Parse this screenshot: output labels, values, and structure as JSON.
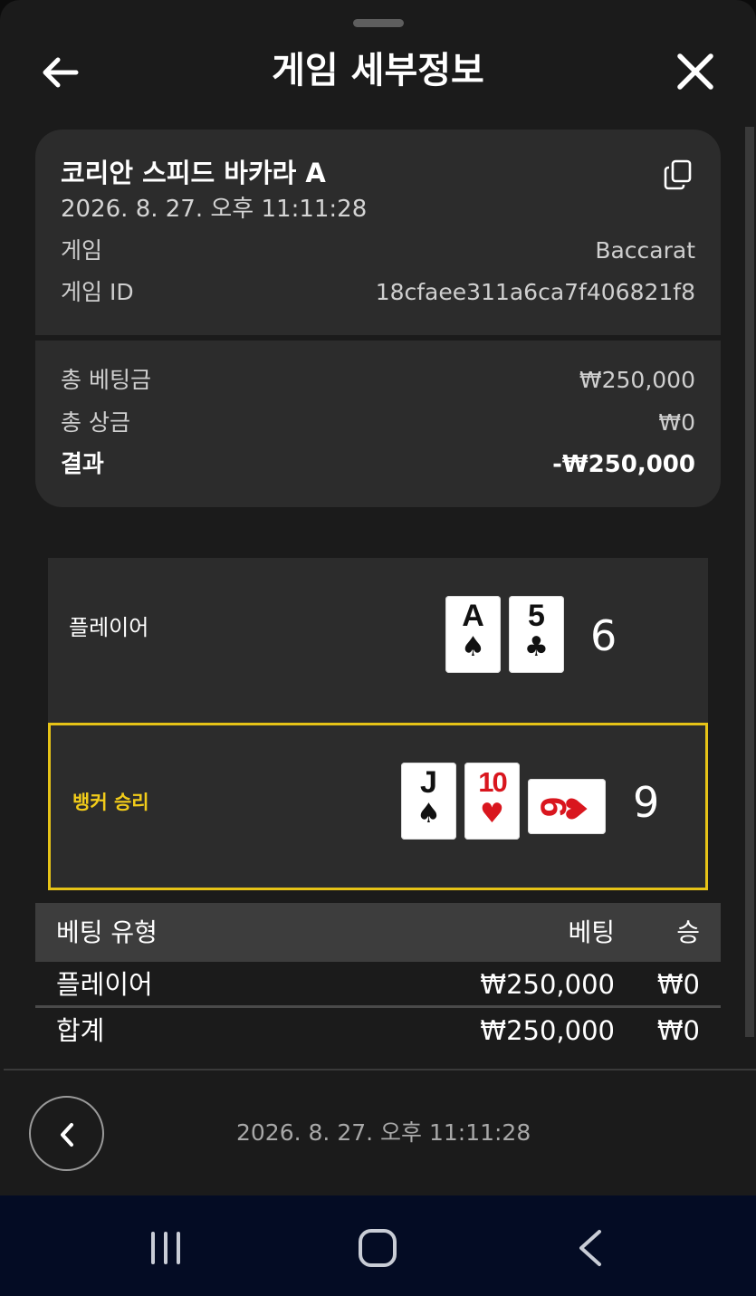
{
  "header": {
    "title": "게임 세부정보",
    "back_icon": "arrow-left-icon",
    "close_icon": "close-icon"
  },
  "summary": {
    "table_name": "코리안 스피드 바카라 A",
    "played_at": "2026. 8. 27. 오후 11:11:28",
    "copy_icon": "copy-icon",
    "game_label": "게임",
    "game_value": "Baccarat",
    "game_id_label": "게임 ID",
    "game_id_value": "18cfaee311a6ca7f406821f8",
    "total_bet_label": "총 베팅금",
    "total_bet_value": "₩250,000",
    "total_win_label": "총 상금",
    "total_win_value": "₩0",
    "result_label": "결과",
    "result_value": "-₩250,000"
  },
  "hands": {
    "player": {
      "label": "플레이어",
      "score": "6",
      "cards": [
        {
          "rank": "A",
          "suit": "♠",
          "color": "#111111"
        },
        {
          "rank": "5",
          "suit": "♣",
          "color": "#111111"
        }
      ]
    },
    "banker": {
      "label": "뱅커 승리",
      "score": "9",
      "highlight_color": "#e6c317",
      "cards": [
        {
          "rank": "J",
          "suit": "♠",
          "color": "#111111"
        },
        {
          "rank": "10",
          "suit": "♥",
          "color": "#d9161e"
        },
        {
          "rank": "9",
          "suit": "♥",
          "color": "#d9161e",
          "orientation": "sideways"
        }
      ]
    }
  },
  "bets": {
    "headers": {
      "type": "베팅 유형",
      "bet": "베팅",
      "win": "승"
    },
    "rows": [
      {
        "type": "플레이어",
        "bet": "₩250,000",
        "win": "₩0"
      }
    ],
    "total": {
      "type": "합계",
      "bet": "₩250,000",
      "win": "₩0"
    }
  },
  "footer": {
    "date": "2026. 8. 27. 오후 11:11:28",
    "prev_icon": "chevron-left-icon"
  },
  "system_nav": {
    "recents_icon": "recents-icon",
    "home_icon": "home-icon",
    "back_icon": "back-icon"
  }
}
